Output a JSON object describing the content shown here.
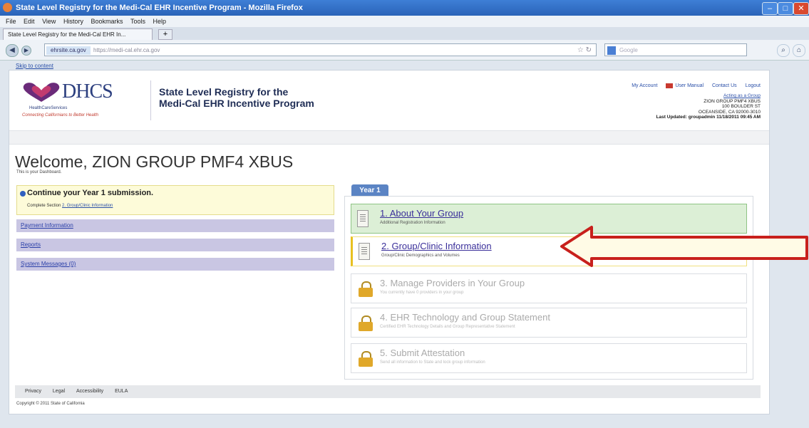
{
  "browser": {
    "window_title": "State Level Registry for the Medi-Cal EHR Incentive Program - Mozilla Firefox",
    "menu": [
      "File",
      "Edit",
      "View",
      "History",
      "Bookmarks",
      "Tools",
      "Help"
    ],
    "tab_label": "State Level Registry for the Medi-Cal EHR In...",
    "new_tab": "+",
    "url_site": "ehrsite.ca.gov",
    "url_path": "https://medi-cal.ehr.ca.gov",
    "search_placeholder": "Google"
  },
  "skip_link": "Skip to content",
  "header": {
    "logo_text": "DHCS",
    "logo_sub": "HealthCareServices",
    "logo_tagline": "Connecting Californians to Better Health",
    "site_title_line1": "State Level Registry for the",
    "site_title_line2": "Medi-Cal EHR Incentive Program",
    "links": {
      "my_account": "My Account",
      "user_manual": "User Manual",
      "contact_us": "Contact Us",
      "logout": "Logout"
    },
    "acting_as": "Acting as a Group",
    "account_name": "ZION GROUP PMF4 XBUS",
    "address1": "100 BOULDER ST",
    "address2": "OCEANSIDE, CA 92000-3010",
    "last_updated": "Last Updated: groupadmin 11/18/2011 09:45 AM"
  },
  "welcome": {
    "title": "Welcome, ZION GROUP PMF4 XBUS",
    "subtitle": "This is your Dashboard."
  },
  "continue_box": {
    "title": "Continue your Year 1 submission.",
    "prefix": "Complete Section",
    "link": "2. Group/Clinic Information"
  },
  "sidebar": {
    "payment": "Payment Information",
    "reports": "Reports",
    "messages": "System Messages (0)"
  },
  "year_tab": "Year 1",
  "steps": [
    {
      "title": "1. About Your Group",
      "desc": "Additional Registration Information",
      "state": "done"
    },
    {
      "title": "2. Group/Clinic Information",
      "desc": "Group/Clinic Demographics and Volumes",
      "state": "current"
    },
    {
      "title": "3. Manage Providers in Your Group",
      "desc": "You currently have 0 providers in your group",
      "state": "locked"
    },
    {
      "title": "4. EHR Technology and Group Statement",
      "desc": "Certified EHR Technology Details and Group Representative Statement",
      "state": "locked"
    },
    {
      "title": "5. Submit Attestation",
      "desc": "Send all information to State and lock group information",
      "state": "locked"
    }
  ],
  "footer": {
    "links": [
      "Privacy",
      "Legal",
      "Accessibility",
      "EULA"
    ],
    "copyright": "Copyright © 2011 State of California"
  },
  "colors": {
    "arrow": "#c8201c",
    "done_step": "#dcefd6",
    "year_tab": "#5b84c4"
  }
}
